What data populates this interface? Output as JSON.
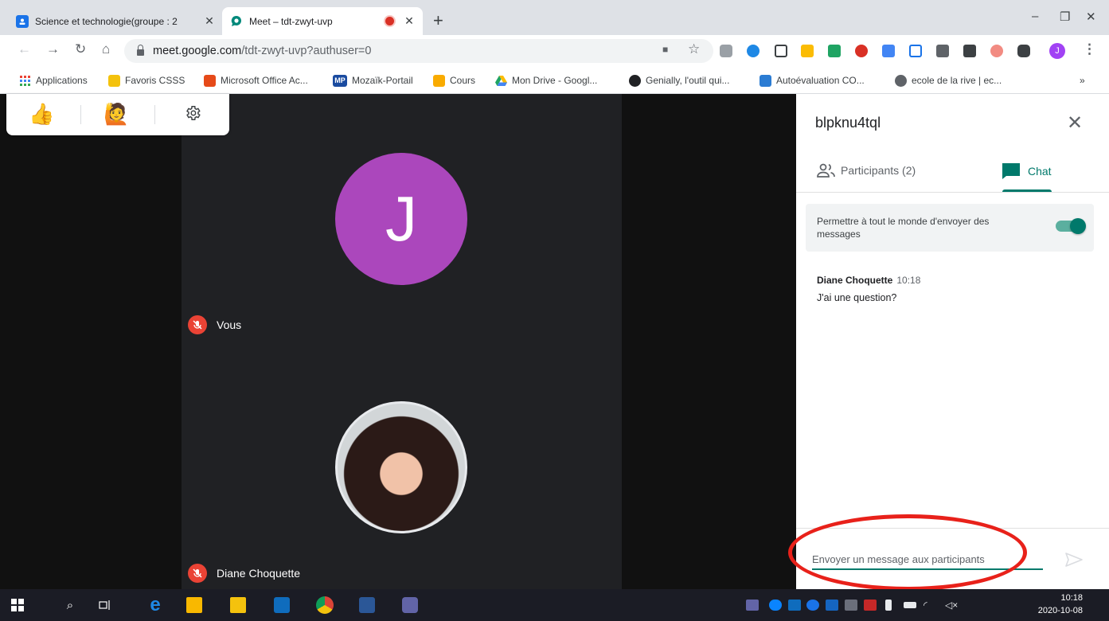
{
  "browser": {
    "tabs": [
      {
        "title": "Science et technologie(groupe : 2",
        "active": false
      },
      {
        "title": "Meet – tdt-zwyt-uvp",
        "active": true,
        "recording": true
      }
    ],
    "new_tab": "+",
    "window": {
      "minimize": "–",
      "restore": "❐",
      "close": "✕"
    },
    "url_host": "meet.google.com",
    "url_path": "/tdt-zwyt-uvp?authuser=0",
    "profile_initial": "J",
    "bookmarks": [
      {
        "label": "Applications",
        "icon": "apps-grid-icon",
        "color": "#ea4335"
      },
      {
        "label": "Favoris CSSS",
        "icon": "folder-icon",
        "color": "#f4c20d"
      },
      {
        "label": "Microsoft Office Ac...",
        "icon": "office-icon",
        "color": "#e64a19"
      },
      {
        "label": "Mozaïk-Portail",
        "icon": "mp-icon",
        "color": "#1a4ba0",
        "badge": "MP"
      },
      {
        "label": "Cours",
        "icon": "classroom-icon",
        "color": "#f9ab00"
      },
      {
        "label": "Mon Drive - Googl...",
        "icon": "drive-icon",
        "color": "#1fa463"
      },
      {
        "label": "Genially, l'outil qui...",
        "icon": "genially-icon",
        "color": "#202124"
      },
      {
        "label": "Autoévaluation CO...",
        "icon": "forms-icon",
        "color": "#2b7cd3"
      },
      {
        "label": "ecole de la rive | ec...",
        "icon": "globe-icon",
        "color": "#5f6368"
      }
    ],
    "bookmarks_overflow": "»"
  },
  "meet": {
    "reactions": [
      "👍",
      "🙋"
    ],
    "tiles": [
      {
        "name": "Vous",
        "avatar_letter": "J",
        "avatar_color": "#ab47bc",
        "muted": true
      },
      {
        "name": "Diane Choquette",
        "muted": true
      }
    ]
  },
  "panel": {
    "meeting_code": "blpknu4tql",
    "close": "✕",
    "tabs": {
      "participants": "Participants (2)",
      "chat": "Chat"
    },
    "active_tab": "chat",
    "permission_text": "Permettre à tout le monde d'envoyer des messages",
    "permission_enabled": true,
    "messages": [
      {
        "sender": "Diane Choquette",
        "time": "10:18",
        "text": "J'ai une question?"
      }
    ],
    "input_placeholder": "Envoyer un message aux participants",
    "accent": "#00796b"
  },
  "taskbar": {
    "time": "10:18",
    "date": "2020-10-08"
  }
}
